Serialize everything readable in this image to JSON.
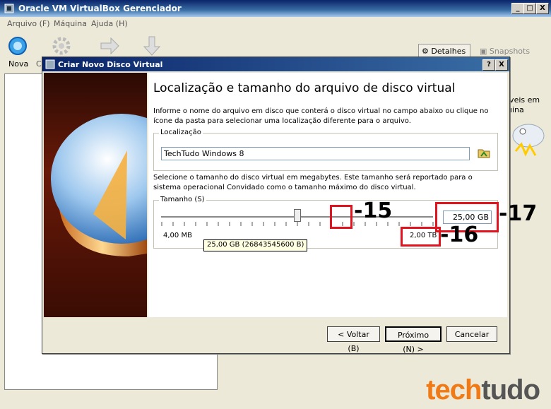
{
  "main_window": {
    "title": "Oracle VM VirtualBox Gerenciador",
    "controls": {
      "minimize": "_",
      "maximize": "□",
      "close": "X"
    },
    "menu": [
      "Arquivo (F)",
      "Máquina",
      "Ajuda (H)"
    ],
    "toolbar": {
      "new_label": "Nova",
      "settings_label": "C"
    },
    "tabs": {
      "details": "Detalhes",
      "snapshots": "Snapshots"
    },
    "right_fragment": [
      "íveis em",
      "uina"
    ]
  },
  "dialog": {
    "title": "Criar Novo Disco Virtual",
    "controls": {
      "help": "?",
      "close": "X"
    },
    "heading": "Localização e tamanho do arquivo de disco virtual",
    "location_desc": "Informe o nome do arquivo em disco que conterá o disco virtual no campo abaixo ou clique no ícone da pasta para selecionar uma localização diferente para o arquivo.",
    "location_group": {
      "label": "Localização",
      "value": "TechTudo Windows 8"
    },
    "size_desc": "Selecione o tamanho do disco virtual em megabytes. Este tamanho será reportado para o sistema operacional Convidado como o tamanho máximo do disco virtual.",
    "size_group": {
      "label": "Tamanho (S)",
      "value": "25,00 GB",
      "min_label": "4,00 MB",
      "max_label": "2,00 TB",
      "tooltip": "25,00 GB (26843545600 B)",
      "slider_fraction": 0.5
    },
    "buttons": {
      "back": "< Voltar (B)",
      "next": "Próximo (N) >",
      "cancel": "Cancelar"
    }
  },
  "annotations": [
    "-15",
    "-16",
    "-17"
  ],
  "brand": {
    "part1": "tech",
    "part2": "tudo",
    "color1": "#f07a16",
    "color2": "#555555"
  },
  "colors": {
    "highlight": "#e0141e",
    "title_bar": "#0a246a"
  }
}
